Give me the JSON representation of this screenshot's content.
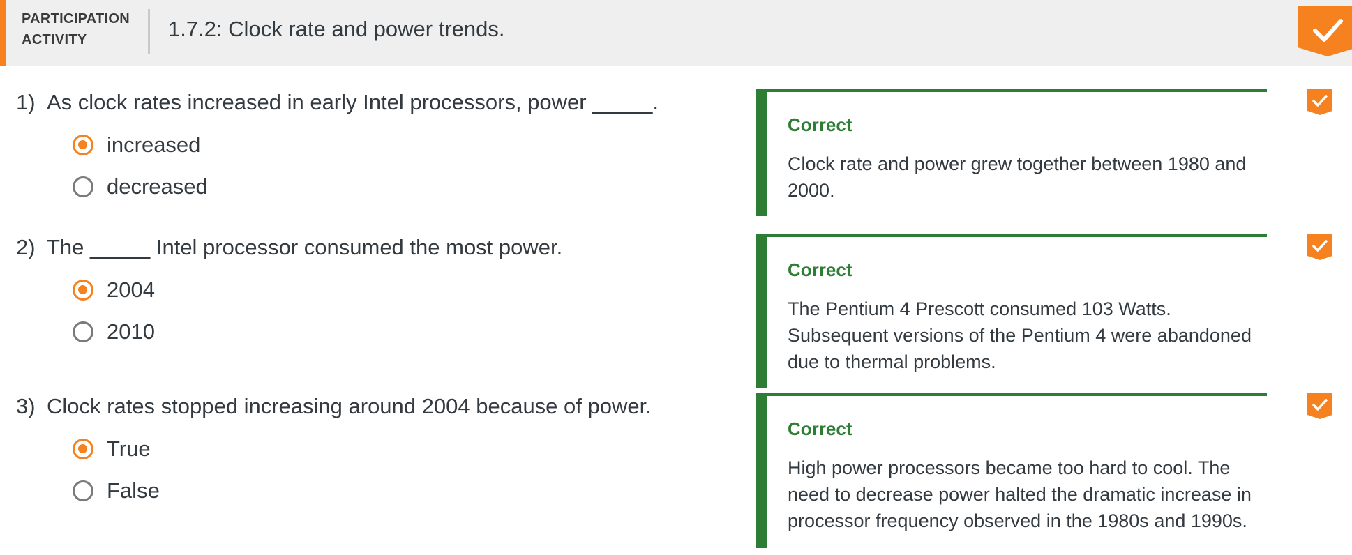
{
  "header": {
    "activity_label_line1": "PARTICIPATION",
    "activity_label_line2": "ACTIVITY",
    "title": "1.7.2: Clock rate and power trends.",
    "completion_icon": "checkmark-icon",
    "completed": true
  },
  "colors": {
    "accent": "#f5821f",
    "correct": "#2d7d34",
    "header_bg": "#efefef",
    "text": "#333a40"
  },
  "questions": [
    {
      "number": "1)",
      "text": "As clock rates increased in early Intel processors, power _____.",
      "options": [
        {
          "label": "increased",
          "selected": true
        },
        {
          "label": "decreased",
          "selected": false
        }
      ],
      "feedback": {
        "status": "Correct",
        "explanation": "Clock rate and power grew together between 1980 and 2000."
      }
    },
    {
      "number": "2)",
      "text": "The _____ Intel processor consumed the most power.",
      "options": [
        {
          "label": "2004",
          "selected": true
        },
        {
          "label": "2010",
          "selected": false
        }
      ],
      "feedback": {
        "status": "Correct",
        "explanation": "The Pentium 4 Prescott consumed 103 Watts. Subsequent versions of the Pentium 4 were abandoned due to thermal problems."
      }
    },
    {
      "number": "3)",
      "text": "Clock rates stopped increasing around 2004 because of power.",
      "options": [
        {
          "label": "True",
          "selected": true
        },
        {
          "label": "False",
          "selected": false
        }
      ],
      "feedback": {
        "status": "Correct",
        "explanation": "High power processors became too hard to cool. The need to decrease power halted the dramatic increase in processor frequency observed in the 1980s and 1990s."
      }
    }
  ]
}
